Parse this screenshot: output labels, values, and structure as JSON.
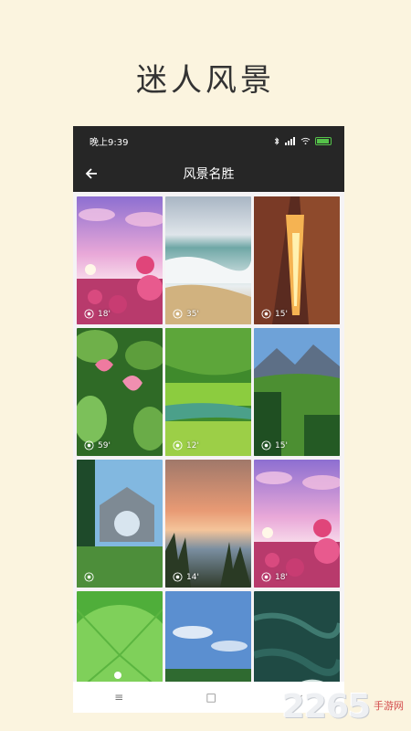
{
  "headline": "迷人风景",
  "status_bar": {
    "time": "晚上9:39"
  },
  "app_bar": {
    "title": "风景名胜",
    "back_icon": "back-arrow-icon"
  },
  "wallpapers": [
    {
      "duration": "18'",
      "scene": "pink-sky-flower-field"
    },
    {
      "duration": "35'",
      "scene": "ocean-waves-beach"
    },
    {
      "duration": "15'",
      "scene": "sunset-canyon"
    },
    {
      "duration": "59'",
      "scene": "lotus-flowers"
    },
    {
      "duration": "12'",
      "scene": "green-meadow-stream"
    },
    {
      "duration": "15'",
      "scene": "mountain-valley-forest"
    },
    {
      "duration": "",
      "scene": "sunlit-house-forest"
    },
    {
      "duration": "14'",
      "scene": "sunset-lake-grass"
    },
    {
      "duration": "18'",
      "scene": "pink-sky-flower-field"
    },
    {
      "duration": "",
      "scene": "lotus-leaf-droplet"
    },
    {
      "duration": "",
      "scene": "blue-sky-field"
    },
    {
      "duration": "",
      "scene": "dark-sea-water"
    }
  ],
  "nav_bar": {
    "menu": "≡",
    "home": "□",
    "back": "‹"
  },
  "watermark": {
    "number": "2265",
    "text": "手游网"
  }
}
